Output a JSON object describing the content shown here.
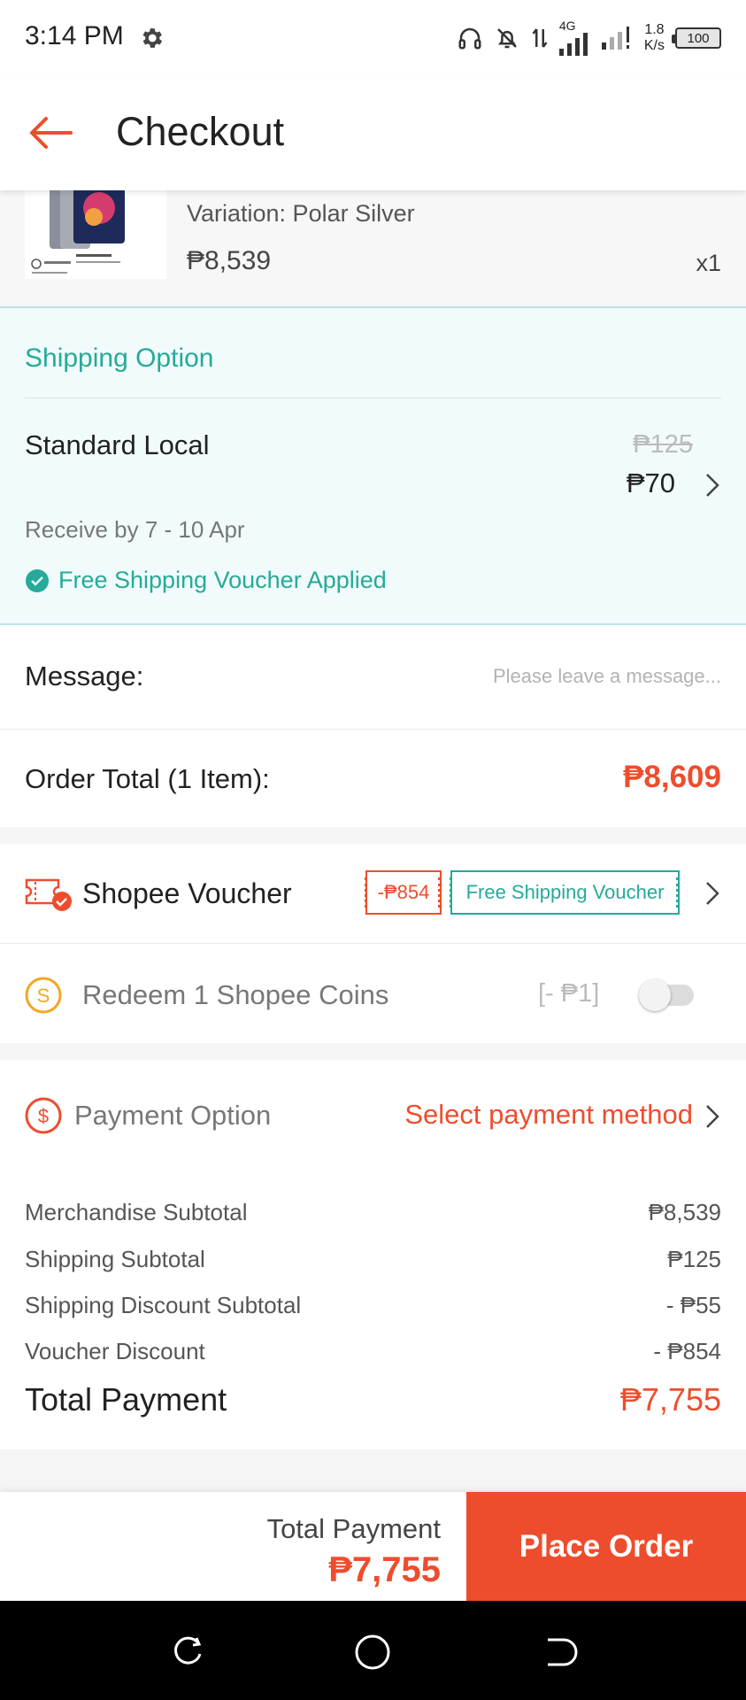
{
  "status_bar": {
    "time": "3:14 PM",
    "network": "4G",
    "speed_value": "1.8",
    "speed_unit": "K/s",
    "battery": "100",
    "icons": [
      "gear-icon",
      "headphones-icon",
      "bell-off-icon",
      "data-arrows-icon",
      "signal-icon",
      "battery-icon"
    ]
  },
  "header": {
    "title": "Checkout",
    "back_icon": "back-arrow-icon",
    "accent": "#ee4d2d"
  },
  "product": {
    "variation": "Variation: Polar Silver",
    "price": "₱8,539",
    "quantity": "x1"
  },
  "shipping": {
    "title": "Shipping Option",
    "method": "Standard Local",
    "original_price": "₱125",
    "price": "₱70",
    "eta": "Receive by 7 - 10 Apr",
    "applied": "Free Shipping Voucher Applied",
    "accent": "#26aa99"
  },
  "message": {
    "label": "Message:",
    "placeholder": "Please leave a message...",
    "value": ""
  },
  "order_total": {
    "label": "Order Total (1 Item):",
    "value": "₱8,609"
  },
  "voucher": {
    "label": "Shopee Voucher",
    "discount_tag": "-₱854",
    "shipping_tag": "Free Shipping Voucher"
  },
  "coins": {
    "label": "Redeem 1 Shopee Coins",
    "value": "[- ₱1]",
    "enabled": false
  },
  "payment": {
    "label": "Payment Option",
    "select_label": "Select payment method",
    "summary": [
      {
        "label": "Merchandise Subtotal",
        "value": "₱8,539"
      },
      {
        "label": "Shipping Subtotal",
        "value": "₱125"
      },
      {
        "label": "Shipping Discount Subtotal",
        "value": "- ₱55"
      },
      {
        "label": "Voucher Discount",
        "value": "- ₱854"
      }
    ],
    "total_label": "Total Payment",
    "total_value": "₱7,755"
  },
  "bottom_bar": {
    "total_label": "Total Payment",
    "total_value": "₱7,755",
    "place_order": "Place Order"
  },
  "nav_bar": {
    "buttons": [
      "recent-apps-icon",
      "home-icon",
      "back-icon"
    ]
  }
}
